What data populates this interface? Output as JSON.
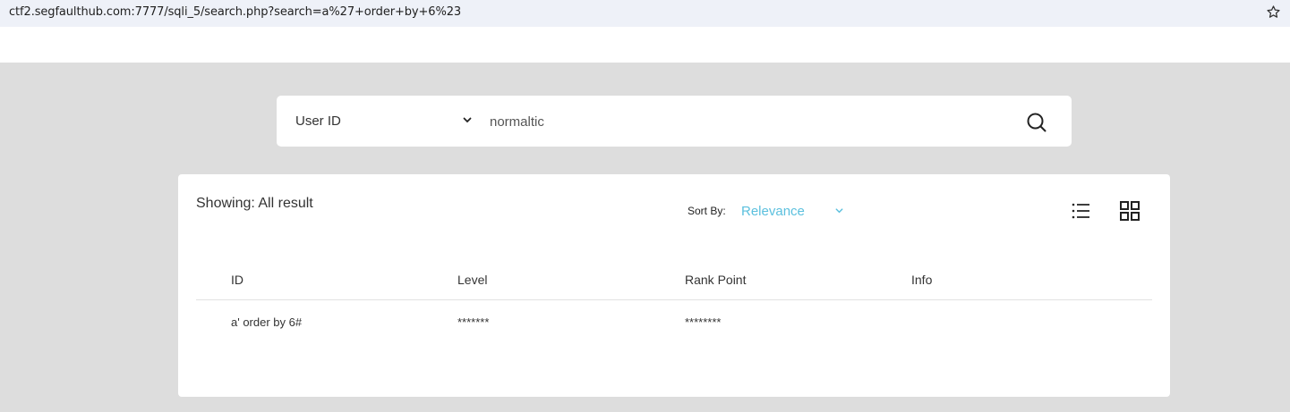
{
  "browser": {
    "url": "ctf2.segfaulthub.com:7777/sqli_5/search.php?search=a%27+order+by+6%23",
    "bookmark_icon": "star-icon"
  },
  "search": {
    "field_select": "User ID",
    "query_value": "normaltic",
    "submit_icon": "search-icon"
  },
  "results": {
    "showing_text": "Showing: All result",
    "sort_label": "Sort By:",
    "sort_value": "Relevance",
    "accent_color": "#5bc0de",
    "view_icons": [
      "list-view-icon",
      "grid-view-icon"
    ],
    "columns": [
      "ID",
      "Level",
      "Rank Point",
      "Info"
    ],
    "rows": [
      {
        "id": "a' order by 6#",
        "level": "*******",
        "rank_point": "********",
        "info": ""
      }
    ]
  }
}
